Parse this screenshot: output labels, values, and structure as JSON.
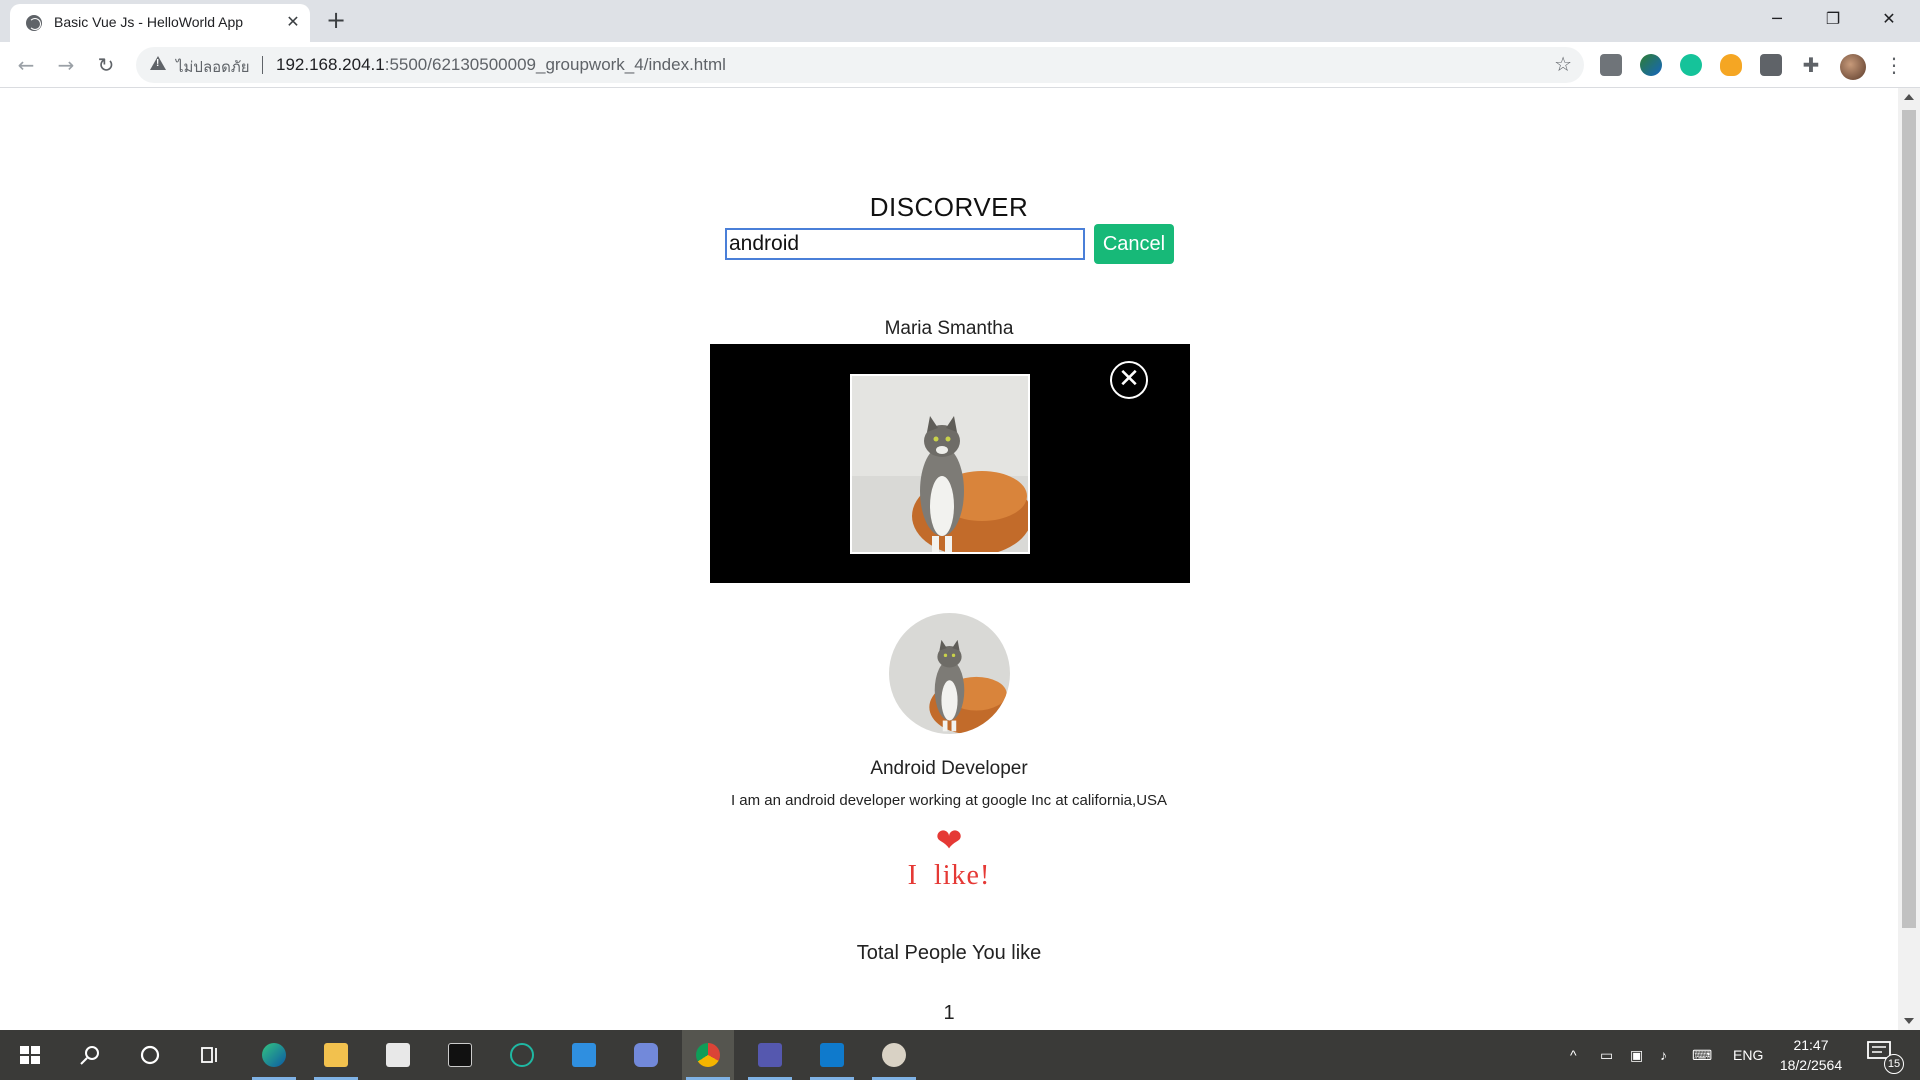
{
  "browser": {
    "tab_title": "Basic Vue Js - HelloWorld App",
    "tab_close_glyph": "✕",
    "new_tab_glyph": "+",
    "insecure_label": "ไม่ปลอดภัย",
    "url_host": "192.168.204.1",
    "url_rest": ":5500/62130500009_groupwork_4/index.html",
    "icons": {
      "back": "←",
      "forward": "→",
      "reload": "↻",
      "star": "☆",
      "menu": "⋮",
      "minimize": "─",
      "maximize": "❐",
      "close": "✕"
    }
  },
  "page": {
    "title": "DISCORVER",
    "search": {
      "value": "android"
    },
    "cancel_label": "Cancel",
    "person_name": "Maria Smantha",
    "close_glyph": "✕",
    "job_title": "Android Developer",
    "bio": "I am an android developer working at google Inc at california,USA",
    "heart_glyph": "❤",
    "like_label": "I  like!",
    "total_label": "Total People You like",
    "total_count": "1"
  },
  "taskbar": {
    "tray_lang": "ENG",
    "clock_time": "21:47",
    "clock_date": "18/2/2564",
    "notification_count": "15",
    "tray_chevron": "^"
  },
  "colors": {
    "accent_button": "#17b978",
    "like_red": "#e53935",
    "input_border": "#4a7fd8",
    "taskbar_bg": "#3a3a38"
  }
}
